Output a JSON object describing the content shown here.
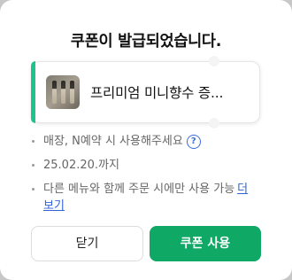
{
  "dialog": {
    "title": "쿠폰이 발급되었습니다."
  },
  "coupon": {
    "name": "프리미엄 미니향수 증...",
    "accent_color": "#1fc48d",
    "thumbnail": "perfume-vials-thumbnail"
  },
  "notes": {
    "usage": "매장, N예약 시 사용해주세요",
    "help_icon": "question-circle-icon",
    "expiry": "25.02.20.까지",
    "menu_text": "다른 메뉴와 함께 주문 시에만 사용 가능",
    "more_link": "더보기"
  },
  "buttons": {
    "close_label": "닫기",
    "use_label": "쿠폰 사용",
    "use_color": "#0fa865"
  }
}
